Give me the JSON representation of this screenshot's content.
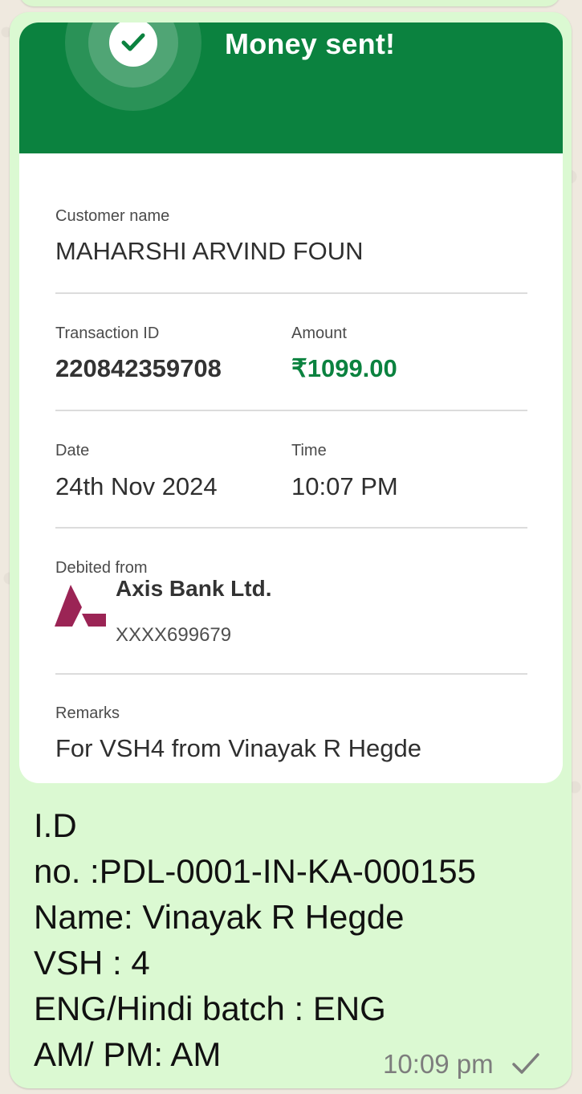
{
  "receipt": {
    "header_title": "Money sent!",
    "customer_label": "Customer name",
    "customer_name": "MAHARSHI ARVIND FOUN",
    "transaction_label": "Transaction ID",
    "transaction_id": "220842359708",
    "amount_label": "Amount",
    "amount": "₹1099.00",
    "date_label": "Date",
    "date": "24th Nov 2024",
    "time_label": "Time",
    "time": "10:07 PM",
    "debited_label": "Debited from",
    "bank_name": "Axis Bank Ltd.",
    "bank_account": "XXXX699679",
    "remarks_label": "Remarks",
    "remarks": "For VSH4 from Vinayak R Hegde",
    "icons": {
      "success": "checkmark-icon",
      "bank_logo": "axis-bank-logo"
    },
    "colors": {
      "header_green": "#0b823f",
      "amount_green": "#0b823f",
      "logo_magenta": "#9b2455"
    }
  },
  "message": {
    "lines": [
      "I.D",
      "no. :PDL-0001-IN-KA-000155",
      "Name: Vinayak R Hegde",
      "VSH  : 4",
      "ENG/Hindi batch : ENG",
      "AM/ PM: AM"
    ],
    "timestamp": "10:09 pm",
    "status_icon": "single-check-icon",
    "bubble_color": "#dbf9d2"
  }
}
